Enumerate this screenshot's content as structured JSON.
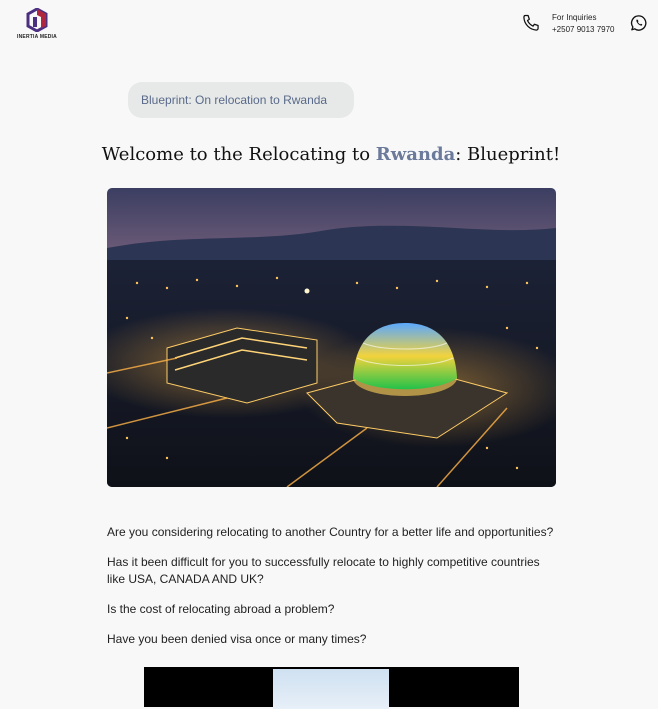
{
  "brand": {
    "name": "INERTIA MEDIA",
    "colors": {
      "purple": "#4b2f80",
      "maroon": "#b0263e",
      "accent": "#6b7a9a"
    }
  },
  "contact": {
    "label": "For Inquiries",
    "phone": "+2507 9013 7970",
    "phone_icon": "phone-icon",
    "whatsapp_icon": "whatsapp-icon"
  },
  "breadcrumb": {
    "label": "Blueprint: On relocation to Rwanda"
  },
  "headline": {
    "before": "Welcome to the Relocating to ",
    "highlight": "Rwanda",
    "after": ": Blueprint!"
  },
  "questions": [
    "Are you considering relocating to another Country for a better life and opportunities?",
    "Has it been difficult for you to successfully relocate to highly competitive countries like USA, CANADA AND UK?",
    "Is the cost of relocating abroad a problem?",
    "Have you been denied visa once or many times?"
  ]
}
